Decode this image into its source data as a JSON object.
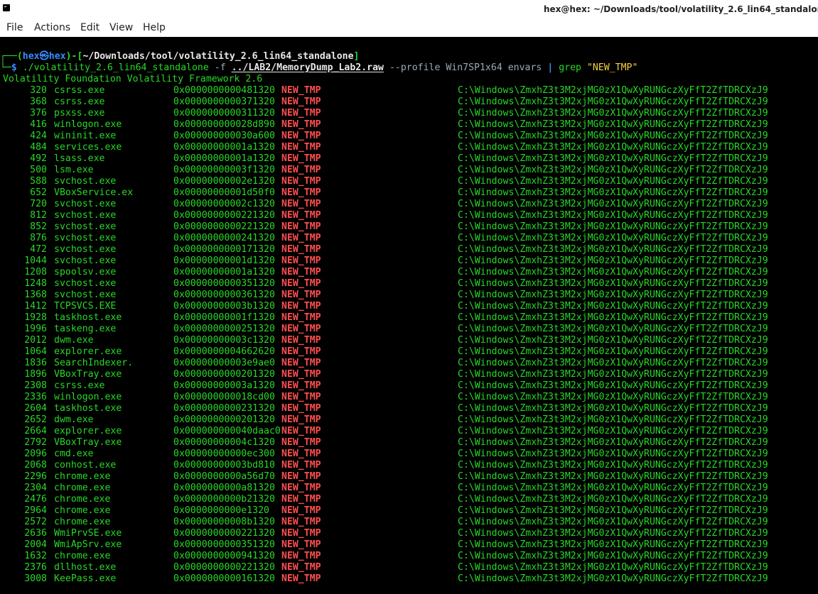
{
  "window": {
    "title": "hex@hex: ~/Downloads/tool/volatility_2.6_lin64_standalone"
  },
  "menu": {
    "items": [
      "File",
      "Actions",
      "Edit",
      "View",
      "Help"
    ]
  },
  "prompt": {
    "user": "hex",
    "skull": "㉿",
    "host": "hex",
    "cwd": "~/Downloads/tool/volatility_2.6_lin64_standalone",
    "dollar": "$",
    "executable": "./volatility_2.6_lin64_standalone",
    "flag_f": "-f",
    "dump_path": "../LAB2/MemoryDump_Lab2.raw",
    "flag_profile": "--profile",
    "profile": "Win7SP1x64",
    "plugin": "envars",
    "pipe": "|",
    "grep": "grep",
    "pattern": "\"NEW_TMP\""
  },
  "output_header": "Volatility Foundation Volatility Framework 2.6",
  "variable": "NEW_TMP",
  "value": "C:\\Windows\\ZmxhZ3t3M2xjMG0zX1QwXyRUNGczXyFfT2ZfTDRCXzJ9",
  "rows": [
    {
      "pid": "320",
      "process": "csrss.exe",
      "block": "0x0000000000481320"
    },
    {
      "pid": "368",
      "process": "csrss.exe",
      "block": "0x0000000000371320"
    },
    {
      "pid": "376",
      "process": "psxss.exe",
      "block": "0x0000000000311320"
    },
    {
      "pid": "416",
      "process": "winlogon.exe",
      "block": "0x000000000028d890"
    },
    {
      "pid": "424",
      "process": "wininit.exe",
      "block": "0x000000000030a600"
    },
    {
      "pid": "484",
      "process": "services.exe",
      "block": "0x00000000001a1320"
    },
    {
      "pid": "492",
      "process": "lsass.exe",
      "block": "0x00000000001a1320"
    },
    {
      "pid": "500",
      "process": "lsm.exe",
      "block": "0x00000000003f1320"
    },
    {
      "pid": "588",
      "process": "svchost.exe",
      "block": "0x00000000002e1320"
    },
    {
      "pid": "652",
      "process": "VBoxService.ex",
      "block": "0x00000000001d50f0"
    },
    {
      "pid": "720",
      "process": "svchost.exe",
      "block": "0x00000000002c1320"
    },
    {
      "pid": "812",
      "process": "svchost.exe",
      "block": "0x0000000000221320"
    },
    {
      "pid": "852",
      "process": "svchost.exe",
      "block": "0x0000000000221320"
    },
    {
      "pid": "876",
      "process": "svchost.exe",
      "block": "0x0000000000241320"
    },
    {
      "pid": "472",
      "process": "svchost.exe",
      "block": "0x0000000000171320"
    },
    {
      "pid": "1044",
      "process": "svchost.exe",
      "block": "0x00000000001d1320"
    },
    {
      "pid": "1208",
      "process": "spoolsv.exe",
      "block": "0x00000000001a1320"
    },
    {
      "pid": "1248",
      "process": "svchost.exe",
      "block": "0x0000000000351320"
    },
    {
      "pid": "1368",
      "process": "svchost.exe",
      "block": "0x0000000000361320"
    },
    {
      "pid": "1412",
      "process": "TCPSVCS.EXE",
      "block": "0x00000000003b1320"
    },
    {
      "pid": "1928",
      "process": "taskhost.exe",
      "block": "0x00000000001f1320"
    },
    {
      "pid": "1996",
      "process": "taskeng.exe",
      "block": "0x0000000000251320"
    },
    {
      "pid": "2012",
      "process": "dwm.exe",
      "block": "0x00000000003c1320"
    },
    {
      "pid": "1064",
      "process": "explorer.exe",
      "block": "0x0000000004662620"
    },
    {
      "pid": "1836",
      "process": "SearchIndexer.",
      "block": "0x00000000003e9ae0"
    },
    {
      "pid": "1896",
      "process": "VBoxTray.exe",
      "block": "0x0000000000201320"
    },
    {
      "pid": "2308",
      "process": "csrss.exe",
      "block": "0x00000000003a1320"
    },
    {
      "pid": "2336",
      "process": "winlogon.exe",
      "block": "0x000000000018cd00"
    },
    {
      "pid": "2604",
      "process": "taskhost.exe",
      "block": "0x0000000000231320"
    },
    {
      "pid": "2652",
      "process": "dwm.exe",
      "block": "0x0000000000201320"
    },
    {
      "pid": "2664",
      "process": "explorer.exe",
      "block": "0x000000000040daac0"
    },
    {
      "pid": "2792",
      "process": "VBoxTray.exe",
      "block": "0x00000000004c1320"
    },
    {
      "pid": "2096",
      "process": "cmd.exe",
      "block": "0x00000000000ec300"
    },
    {
      "pid": "2068",
      "process": "conhost.exe",
      "block": "0x00000000003bd810"
    },
    {
      "pid": "2296",
      "process": "chrome.exe",
      "block": "0x0000000000a56d70"
    },
    {
      "pid": "2304",
      "process": "chrome.exe",
      "block": "0x0000000000a81320"
    },
    {
      "pid": "2476",
      "process": "chrome.exe",
      "block": "0x0000000000b21320"
    },
    {
      "pid": "2964",
      "process": "chrome.exe",
      "block": "0x0000000000e1320"
    },
    {
      "pid": "2572",
      "process": "chrome.exe",
      "block": "0x00000000008b1320"
    },
    {
      "pid": "2636",
      "process": "WmiPrvSE.exe",
      "block": "0x0000000000221320"
    },
    {
      "pid": "2004",
      "process": "WmiApSrv.exe",
      "block": "0x0000000000351320"
    },
    {
      "pid": "1632",
      "process": "chrome.exe",
      "block": "0x0000000000941320"
    },
    {
      "pid": "2376",
      "process": "dllhost.exe",
      "block": "0x0000000000221320"
    },
    {
      "pid": "3008",
      "process": "KeePass.exe",
      "block": "0x0000000000161320"
    }
  ],
  "colors": {
    "terminal_bg": "#000000",
    "output_green": "#27d827",
    "variable_red": "#ff4f4f",
    "prompt_blue": "#3a8cff",
    "string_yellow": "#f2d044"
  },
  "icons": {
    "app": "terminal-icon"
  }
}
